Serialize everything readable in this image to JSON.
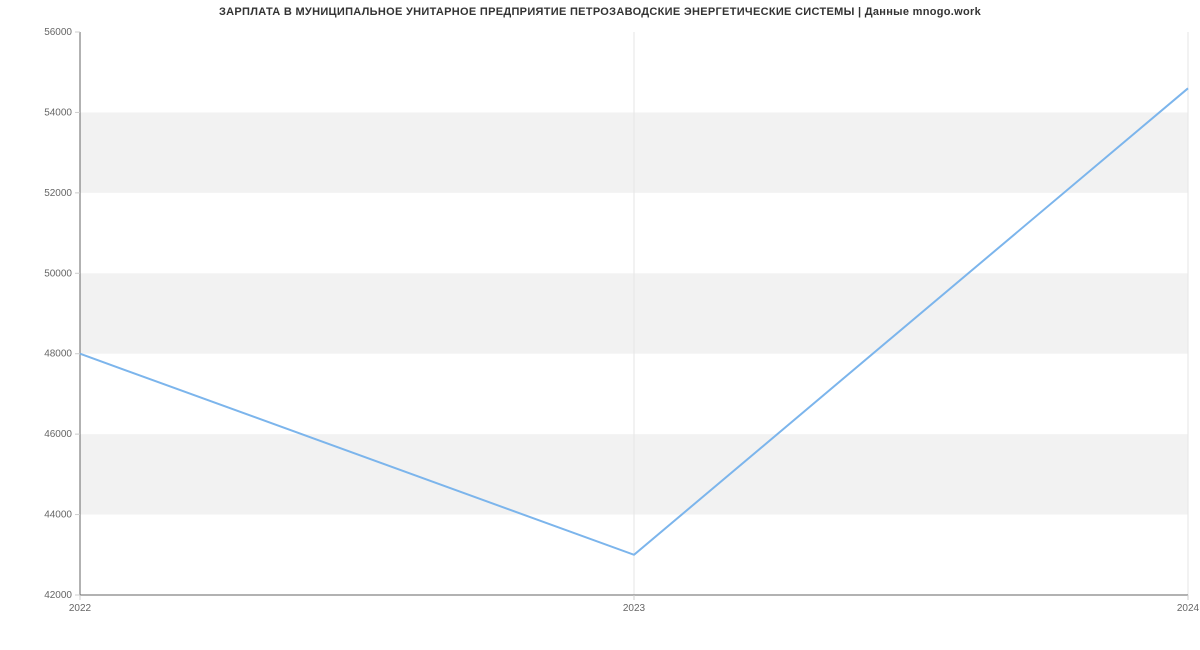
{
  "chart_data": {
    "type": "line",
    "title": "ЗАРПЛАТА В МУНИЦИПАЛЬНОЕ УНИТАРНОЕ ПРЕДПРИЯТИЕ ПЕТРОЗАВОДСКИЕ ЭНЕРГЕТИЧЕСКИЕ СИСТЕМЫ | Данные mnogo.work",
    "x": [
      2022,
      2023,
      2024
    ],
    "values": [
      48000,
      43000,
      54600
    ],
    "xlabel": "",
    "ylabel": "",
    "ylim": [
      42000,
      56000
    ],
    "y_ticks": [
      42000,
      44000,
      46000,
      48000,
      50000,
      52000,
      54000,
      56000
    ],
    "x_ticks": [
      2022,
      2023,
      2024
    ],
    "x_tick_labels": [
      "2022",
      "2023",
      "2024"
    ],
    "line_color": "#7cb5ec",
    "band_color": "#f2f2f2"
  }
}
